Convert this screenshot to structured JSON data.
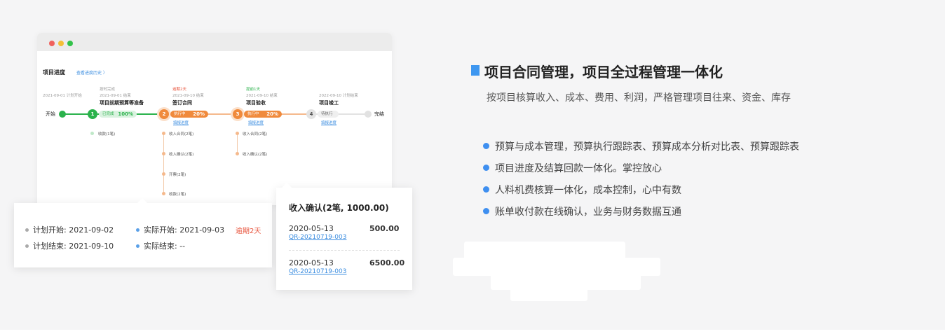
{
  "section": {
    "heading": "项目合同管理，项目全过程管理一体化",
    "description": "按项目核算收入、成本、费用、利润，严格管理项目往来、资金、库存",
    "features": [
      "预算与成本管理，预算执行跟踪表、预算成本分析对比表、预算跟踪表",
      "项目进度及结算回款一体化。掌控放心",
      "人料机费核算一体化，成本控制，心中有数",
      "账单收付款在线确认，业务与财务数据互通"
    ]
  },
  "progress": {
    "title": "项目进度",
    "history_link": "查看进度历史 〉",
    "start_label": "开始",
    "end_label": "完结",
    "stages": [
      {
        "num": "1",
        "status_tag": "按时完成",
        "date": "2021-09-01 结束",
        "name": "项目前期预算等准备",
        "pill": "已完成",
        "percent": "100%",
        "items": [
          "收款(1笔)"
        ]
      },
      {
        "num": "2",
        "status_tag": "逾期2天",
        "date": "2021-09-10 结束",
        "name": "签订合同",
        "pill": "执行中",
        "percent": "20%",
        "sub_link": "填报进度",
        "items": [
          "收入合同(2笔)",
          "收入确认(2笔)",
          "开票(2笔)",
          "收款(2笔)"
        ]
      },
      {
        "num": "3",
        "status_tag": "提前1天",
        "date": "2021-09-10 结束",
        "name": "项目验收",
        "pill": "执行中",
        "percent": "20%",
        "sub_link": "填报进度",
        "items": [
          "收入合同(2笔)",
          "收入确认(2笔)"
        ]
      },
      {
        "num": "4",
        "status_tag": "",
        "date": "2022-09-10 计划结束",
        "name": "项目竣工",
        "pill": "待执行",
        "percent": "",
        "sub_link": "填报进度",
        "items": []
      }
    ],
    "start_date": "2021-09-01 计划开始"
  },
  "plan_card": {
    "plan_start": "计划开始: 2021-09-02",
    "plan_end": "计划结束: 2021-09-10",
    "actual_start": "实际开始: 2021-09-03",
    "actual_end": "实际结束: --",
    "overdue": "逾期2天"
  },
  "receipt_card": {
    "title": "收入确认(2笔, 1000.00)",
    "entries": [
      {
        "date": "2020-05-13",
        "amount": "500.00",
        "code": "QR-20210719-003"
      },
      {
        "date": "2020-05-13",
        "amount": "6500.00",
        "code": "QR-20210719-003"
      }
    ]
  },
  "colors": {
    "accent": "#3e97f0",
    "orange": "#f08a3c",
    "green": "#2bb24c",
    "red": "#e8553e"
  }
}
